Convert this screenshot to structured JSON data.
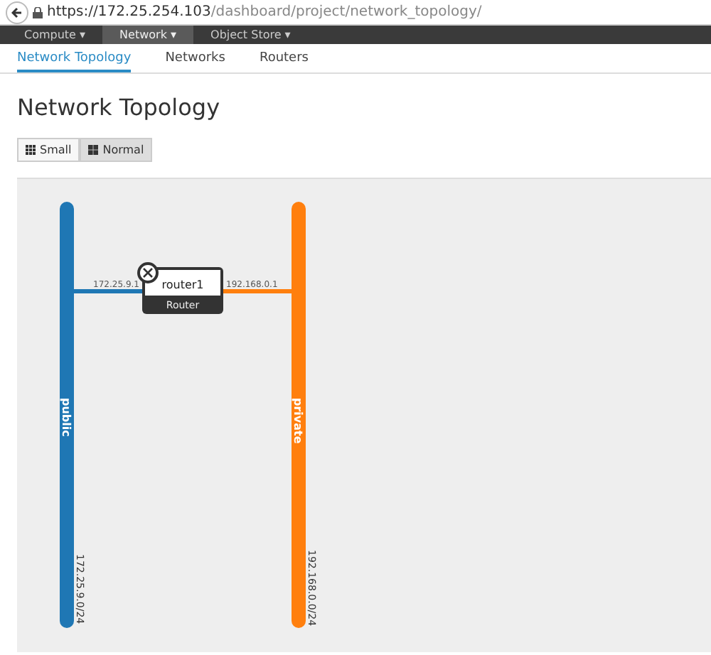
{
  "browser": {
    "url_host": "https://172.25.254.103",
    "url_path": "/dashboard/project/network_topology/"
  },
  "top_nav": [
    {
      "label": "Compute ▾",
      "selected": false
    },
    {
      "label": "Network ▾",
      "selected": true
    },
    {
      "label": "Object Store ▾",
      "selected": false
    }
  ],
  "tabs": [
    {
      "label": "Network Topology",
      "selected": true
    },
    {
      "label": "Networks",
      "selected": false
    },
    {
      "label": "Routers",
      "selected": false
    }
  ],
  "heading": "Network Topology",
  "view_buttons": [
    {
      "label": "Small",
      "selected": false
    },
    {
      "label": "Normal",
      "selected": true
    }
  ],
  "topology": {
    "networks": [
      {
        "name": "public",
        "cidr": "172.25.9.0/24",
        "color": "#1f77b4"
      },
      {
        "name": "private",
        "cidr": "192.168.0.0/24",
        "color": "#ff7f0e"
      }
    ],
    "routers": [
      {
        "name": "router1",
        "type": "Router",
        "ports": [
          {
            "ip": "172.25.9.1"
          },
          {
            "ip": "192.168.0.1"
          }
        ]
      }
    ]
  }
}
